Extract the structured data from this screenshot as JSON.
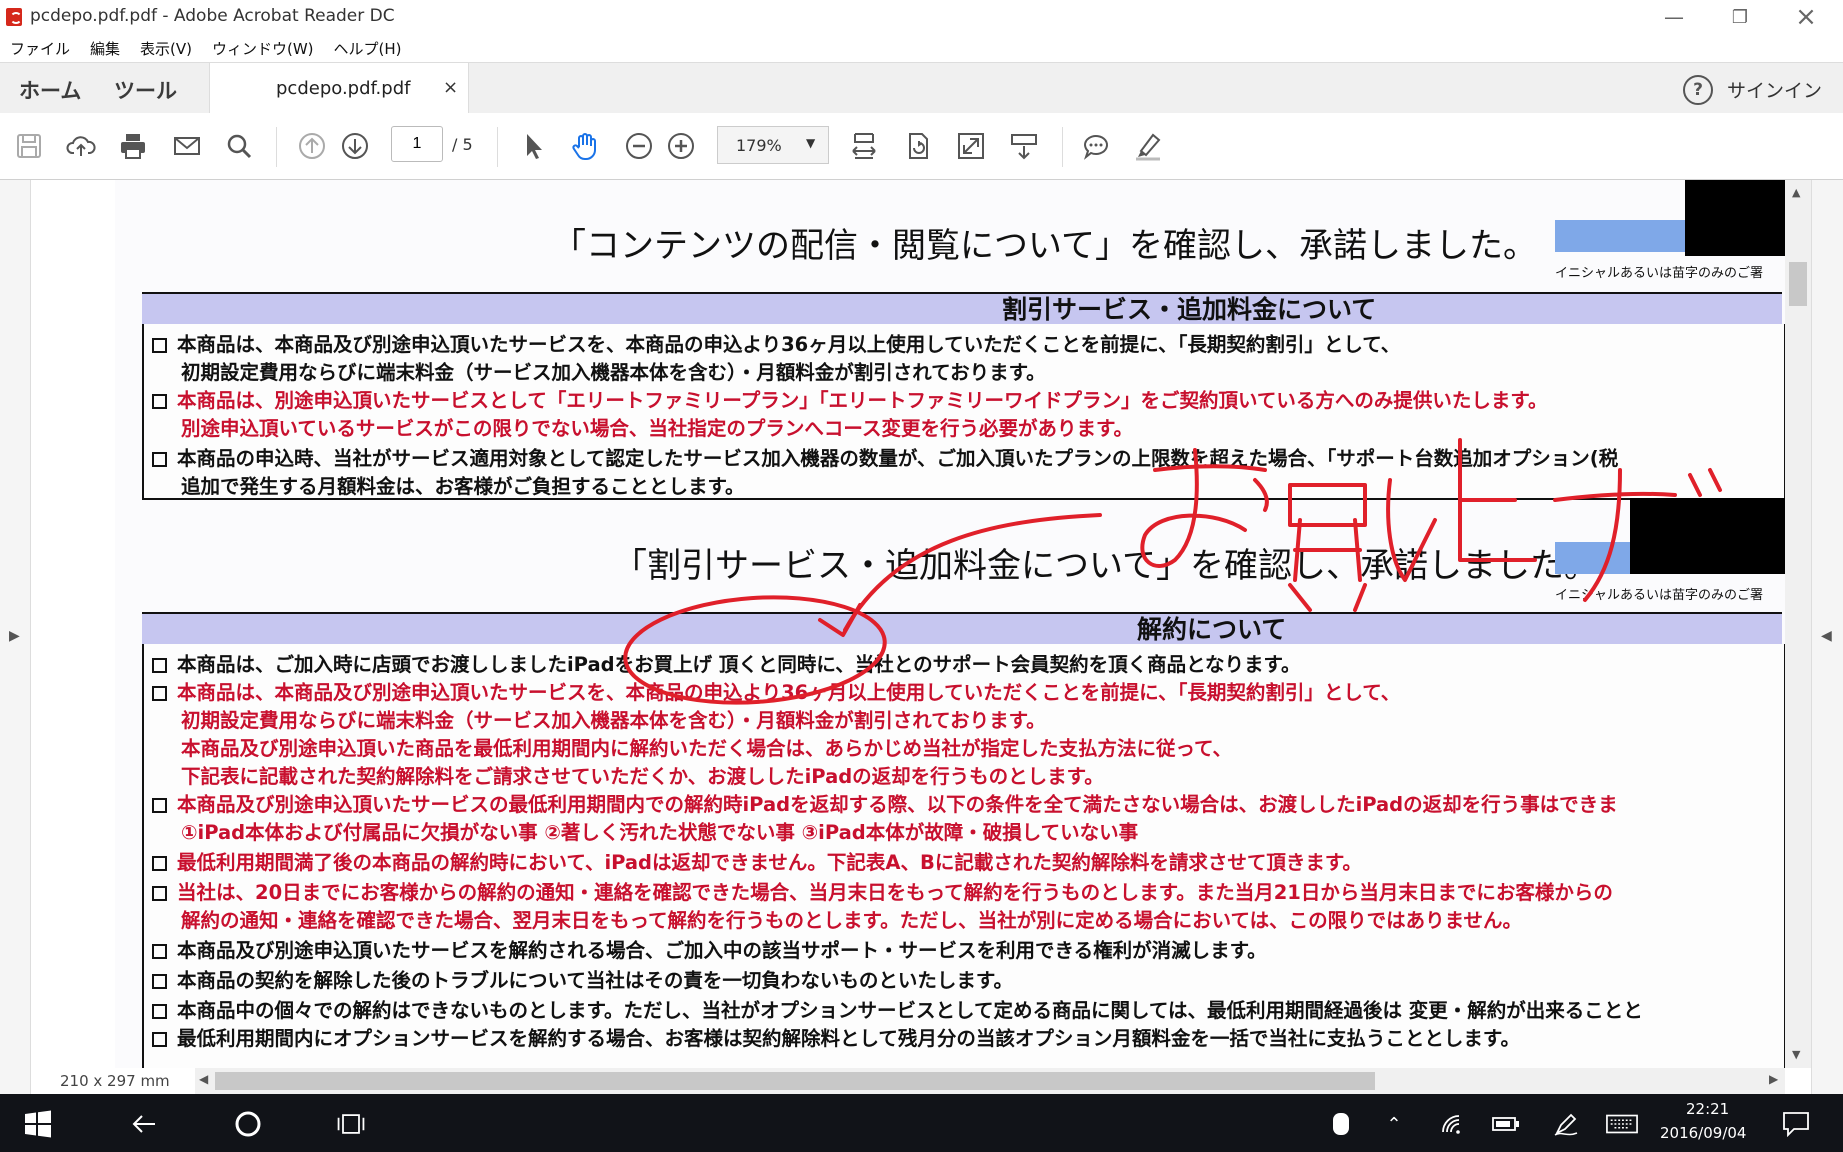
{
  "window": {
    "title": "pcdepo.pdf.pdf - Adobe Acrobat Reader DC"
  },
  "menu": [
    "ファイル",
    "編集",
    "表示(V)",
    "ウィンドウ(W)",
    "ヘルプ(H)"
  ],
  "tabs": {
    "home": "ホーム",
    "tools": "ツール",
    "document": "pcdepo.pdf.pdf",
    "close": "×",
    "signin": "サインイン",
    "help": "?"
  },
  "toolbar": {
    "page_current": "1",
    "page_total": "/ 5",
    "zoom": "179%"
  },
  "status": {
    "page_size": "210 x 297 mm"
  },
  "document": {
    "heading1": "「コンテンツの配信・閲覧について」を確認し、承諾しました。",
    "initial_note1": "イニシャルあるいは苗字のみのご署",
    "section1_title": "割引サービス・追加料金について",
    "section1_lines": [
      "本商品は、本商品及び別途申込頂いたサービスを、本商品の申込より36ヶ月以上使用していただくことを前提に、「長期契約割引」として、",
      "初期設定費用ならびに端末料金（サービス加入機器本体を含む）・月額料金が割引されております。",
      "本商品は、別途申込頂いたサービスとして「エリートファミリープラン」「エリートファミリーワイドプラン」をご契約頂いている方へのみ提供いたします。",
      "別途申込頂いているサービスがこの限りでない場合、当社指定のプランへコース変更を行う必要があります。",
      "本商品の申込時、当社がサービス適用対象として認定したサービス加入機器の数量が、ご加入頂いたプランの上限数を超えた場合、「サポート台数追加オプション(税",
      "追加で発生する月額料金は、お客様がご負担することとします。"
    ],
    "heading2": "「割引サービス・追加料金について」を確認し、承諾しました。",
    "initial_note2": "イニシャルあるいは苗字のみのご署",
    "handwriting": "お買い上げ",
    "section2_title": "解約について",
    "section2_lines": [
      "本商品は、ご加入時に店頭でお渡ししましたiPadをお買上げ 頂くと同時に、当社とのサポート会員契約を頂く商品となります。",
      "本商品は、本商品及び別途申込頂いたサービスを、本商品の申込より36ヶ月以上使用していただくことを前提に、「長期契約割引」として、",
      "初期設定費用ならびに端末料金（サービス加入機器本体を含む）・月額料金が割引されております。",
      "本商品及び別途申込頂いた商品を最低利用期間内に解約いただく場合は、あらかじめ当社が指定した支払方法に従って、",
      "下記表に記載された契約解除料をご請求させていただくか、お渡ししたiPadの返却を行うものとします。",
      "本商品及び別途申込頂いたサービスの最低利用期間内での解約時iPadを返却する際、以下の条件を全て満たさない場合は、お渡ししたiPadの返却を行う事はできま",
      "①iPad本体および付属品に欠損がない事 ②著しく汚れた状態でない事 ③iPad本体が故障・破損していない事",
      "最低利用期間満了後の本商品の解約時において、iPadは返却できません。下記表A、Bに記載された契約解除料を請求させて頂きます。",
      "当社は、20日までにお客様からの解約の通知・連絡を確認できた場合、当月末日をもって解約を行うものとします。また当月21日から当月末日までにお客様からの",
      "解約の通知・連絡を確認できた場合、翌月末日をもって解約を行うものとします。ただし、当社が別に定める場合においては、この限りではありません。",
      "本商品及び別途申込頂いたサービスを解約される場合、ご加入中の該当サポート・サービスを利用できる権利が消滅します。",
      "本商品の契約を解除した後のトラブルについて当社はその責を一切負わないものといたします。",
      "本商品中の個々での解約はできないものとします。ただし、当社がオプションサービスとして定める商品に関しては、最低利用期間経過後は 変更・解約が出来ることと",
      "最低利用期間内にオプションサービスを解約する場合、お客様は契約解除料として残月分の当該オプション月額料金を一括で当社に支払うこととします。"
    ]
  },
  "taskbar": {
    "time": "22:21",
    "date": "2016/09/04"
  },
  "colors": {
    "highlight": "#f4f05a",
    "annotation": "#e0202a",
    "section_header": "#c6c6f0",
    "red_text": "#c8102e"
  }
}
